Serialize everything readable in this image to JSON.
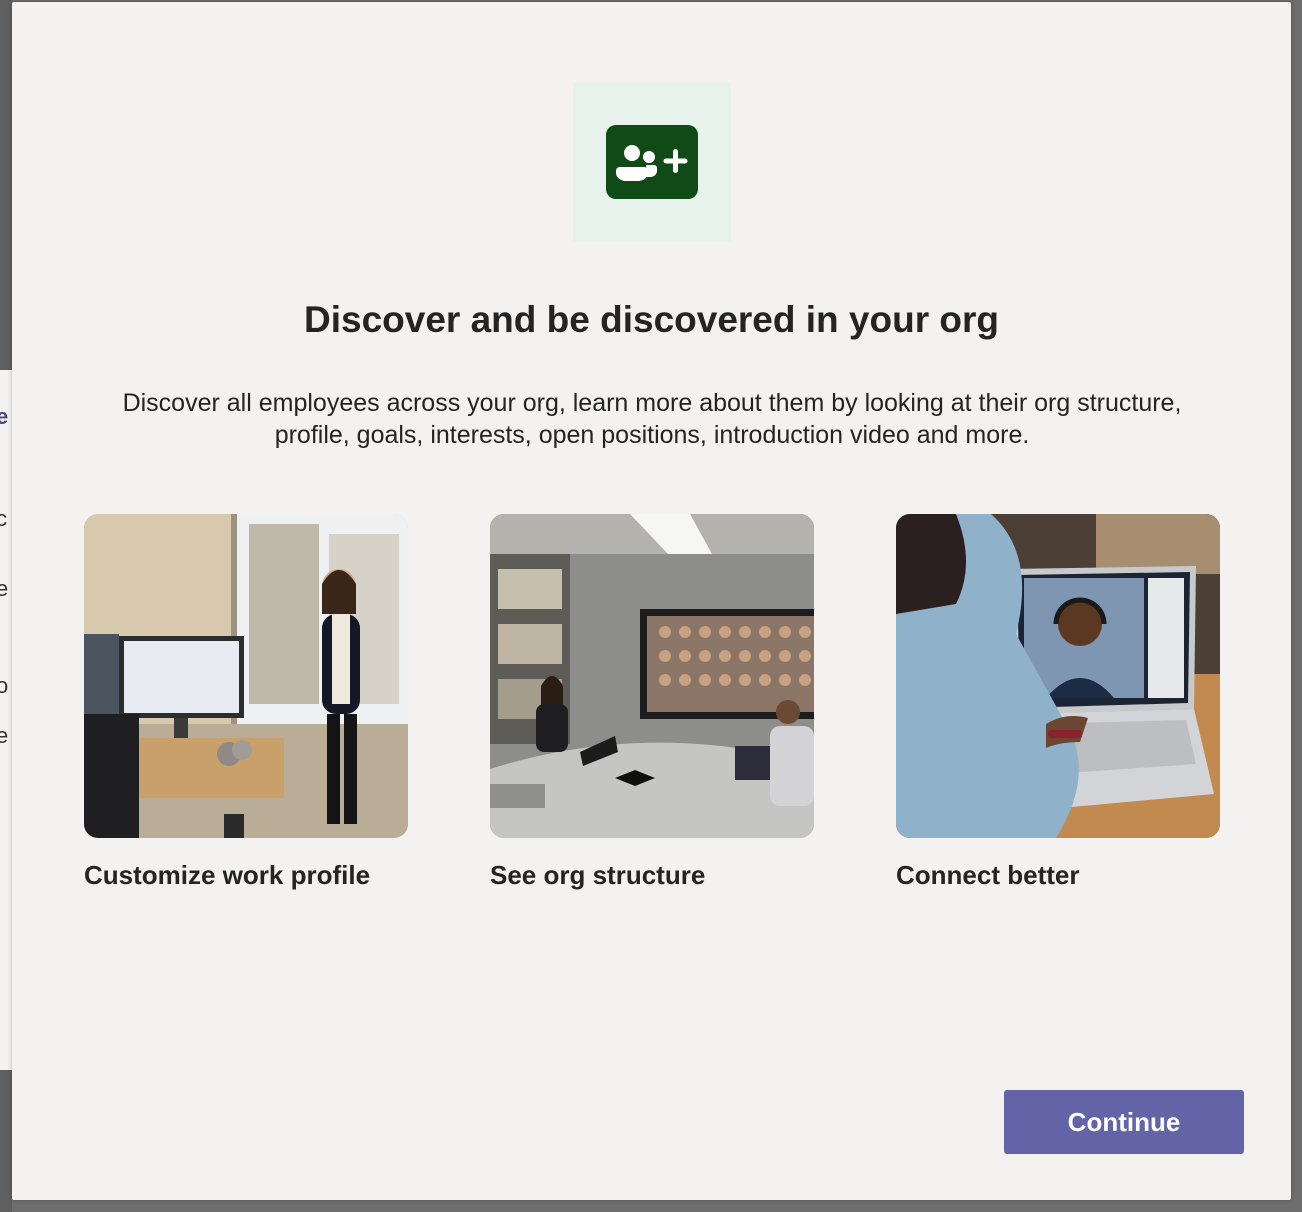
{
  "dialog": {
    "icon": "people-add-icon",
    "title": "Discover and be discovered in your org",
    "description": "Discover all employees across your org, learn more about them by looking at their org structure, profile, goals, interests, open positions, introduction video and more.",
    "features": [
      {
        "label": "Customize work profile",
        "image": "woman-presenting-at-desk-photo"
      },
      {
        "label": "See org structure",
        "image": "meeting-room-video-call-photo"
      },
      {
        "label": "Connect better",
        "image": "laptop-video-call-photo"
      }
    ],
    "continue_label": "Continue"
  },
  "background_fragments": [
    "e",
    "c",
    "e",
    "o",
    "e"
  ],
  "colors": {
    "dialog_background": "#f3f2f1",
    "icon_tile": "#e7f2ec",
    "icon_fill": "#0f4a17",
    "primary_button": "#6264a7",
    "text": "#242424"
  }
}
